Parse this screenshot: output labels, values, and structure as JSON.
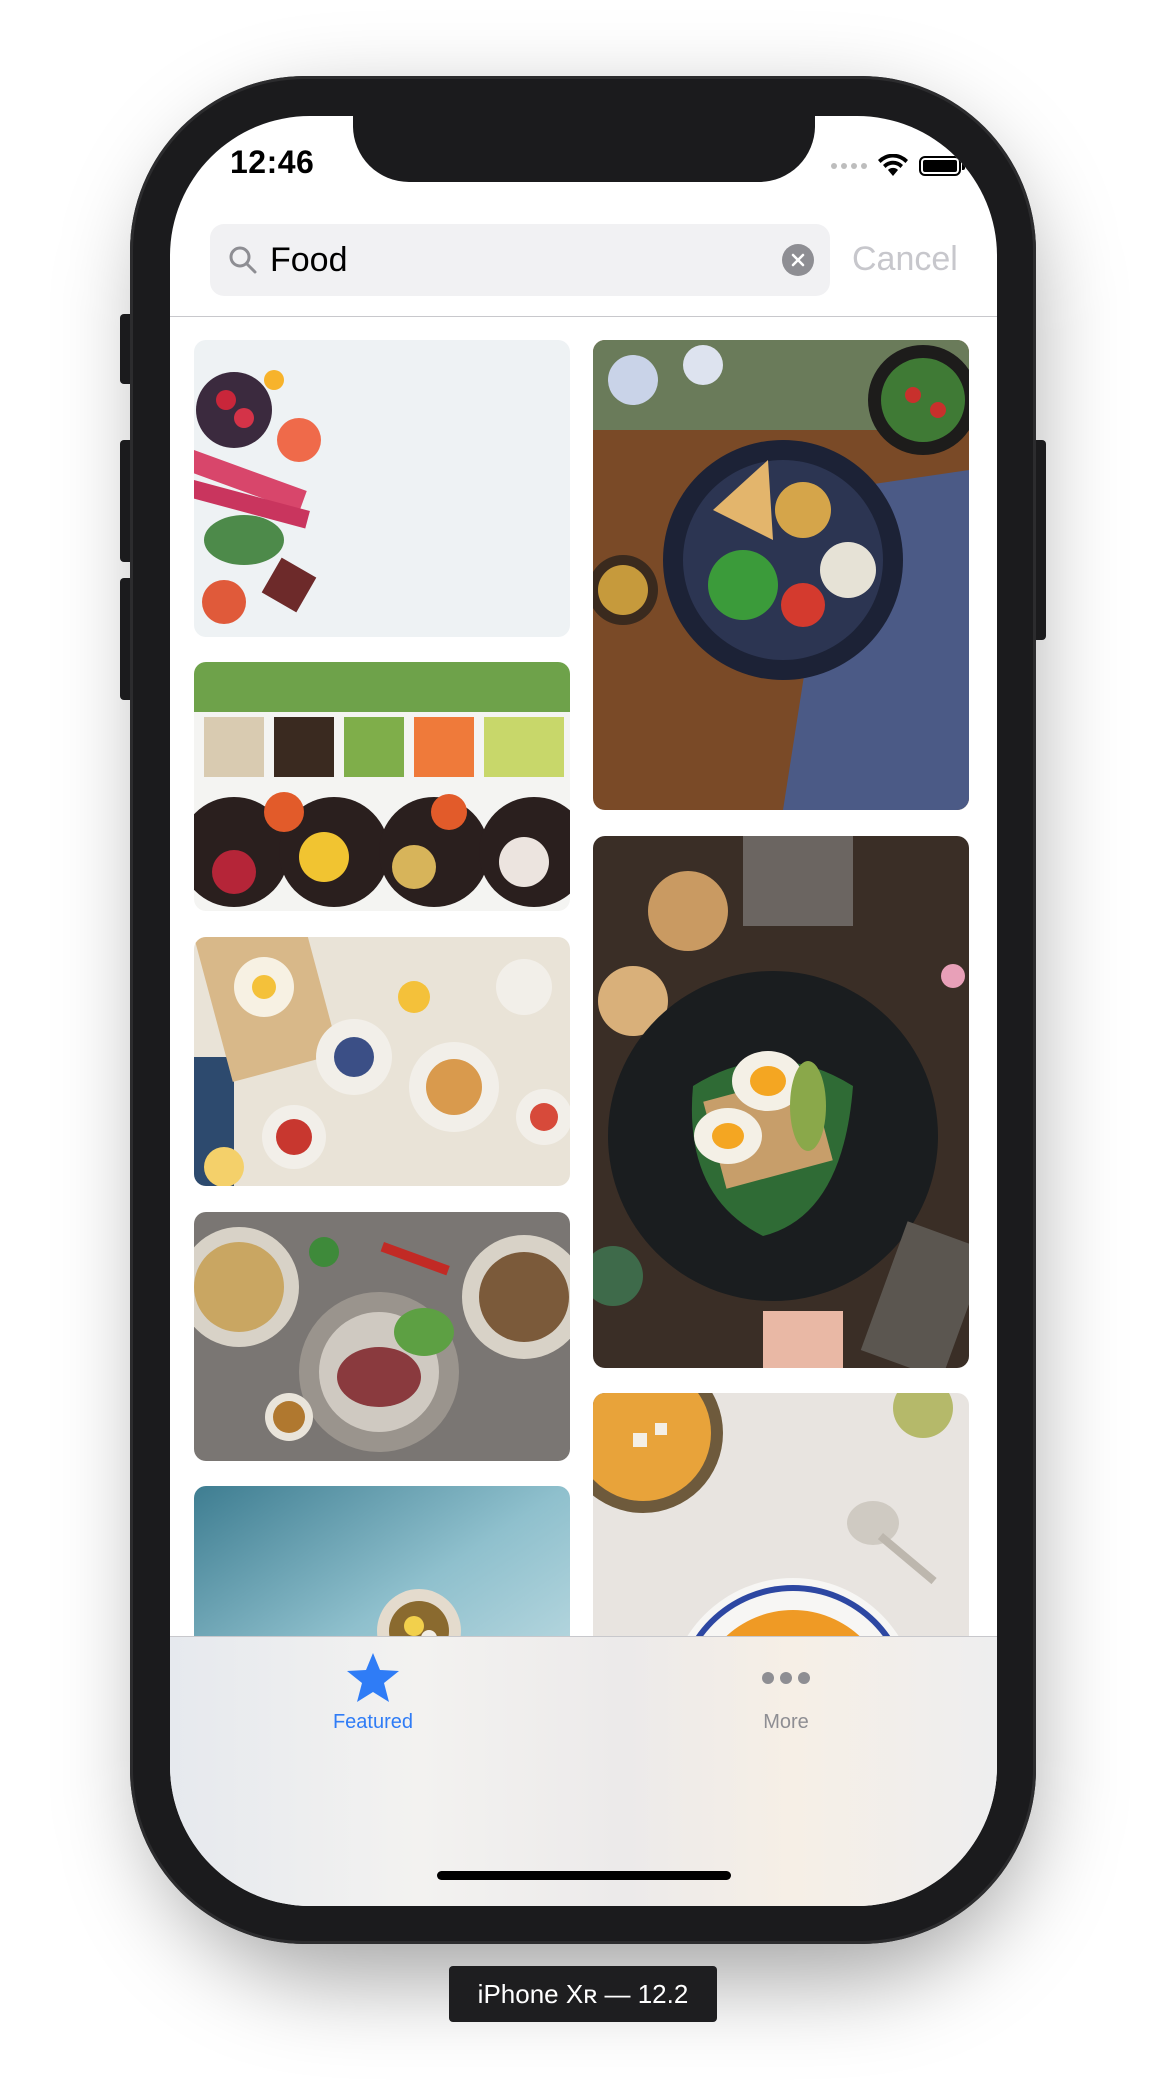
{
  "status_bar": {
    "time": "12:46"
  },
  "search": {
    "query": "Food",
    "cancel_label": "Cancel"
  },
  "tabs": [
    {
      "label": "Featured",
      "selected": true
    },
    {
      "label": "More",
      "selected": false
    }
  ],
  "device_label": "iPhone Xʀ — 12.2",
  "colors": {
    "accent": "#2f7cf6",
    "frame": "#1b1b1d",
    "inactive_tab": "#8e8e93"
  }
}
